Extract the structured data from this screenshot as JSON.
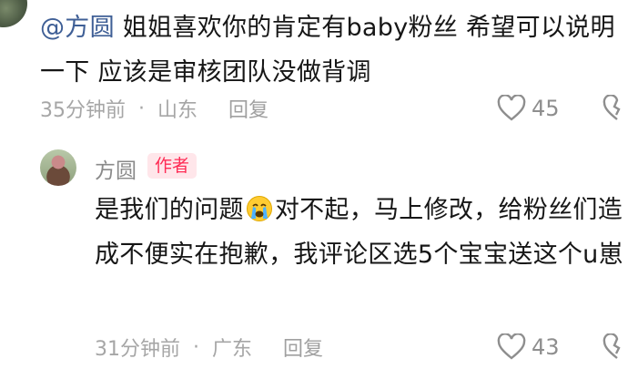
{
  "comment": {
    "mention": "@方圆",
    "text": " 姐姐喜欢你的肯定有baby粉丝 希望可以说明一下 应该是审核团队没做背调",
    "time": "35分钟前",
    "location": "山东",
    "reply_label": "回复",
    "likes": "45"
  },
  "reply": {
    "name": "方圆",
    "badge": "作者",
    "text_before_emoji": "是我们的问题",
    "emoji": "crying-face-emoji",
    "text_after_emoji": "对不起，马上修改，给粉丝们造成不便实在抱歉，我评论区选5个宝宝送这个u崽",
    "time": "31分钟前",
    "location": "广东",
    "reply_label": "回复",
    "likes": "43"
  },
  "colors": {
    "mention": "#3f5f96",
    "badge_bg": "#ffe6ea",
    "badge_text": "#ff2c55",
    "meta_text": "#a6a6a6"
  }
}
